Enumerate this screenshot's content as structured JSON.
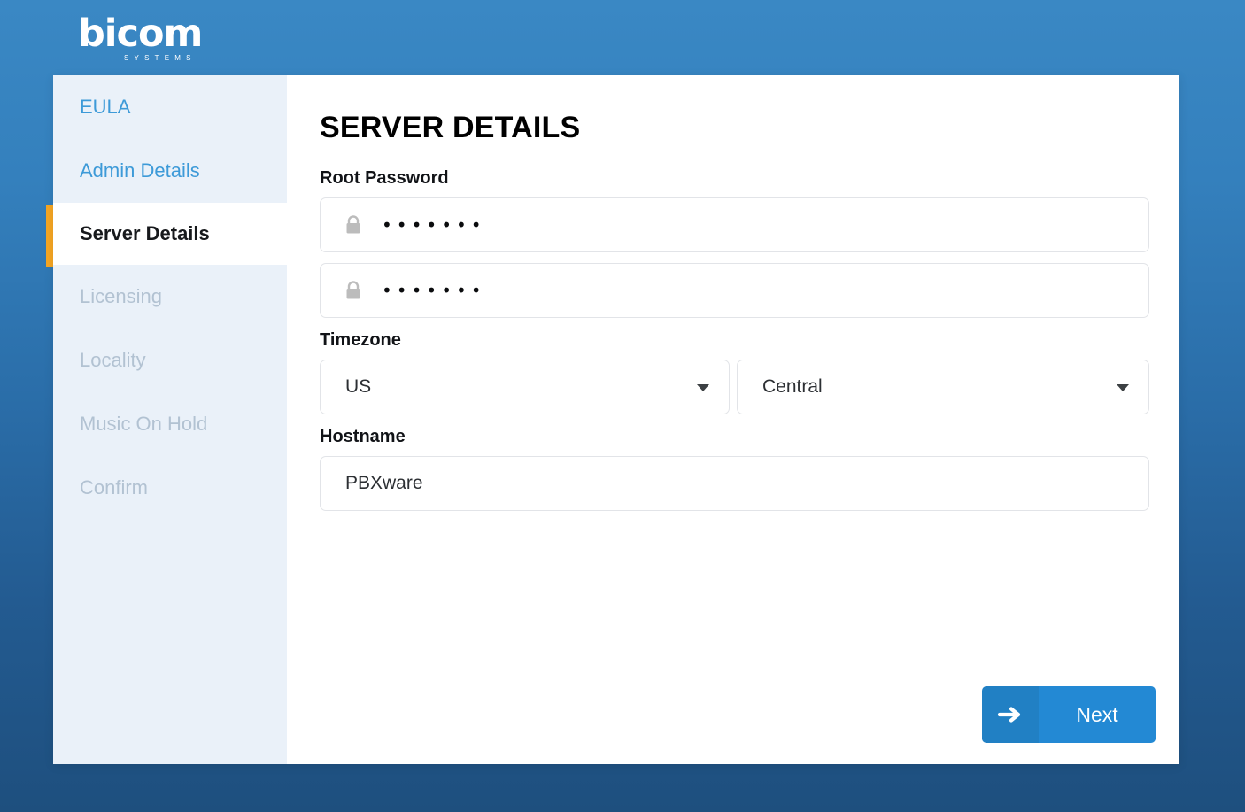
{
  "brand": {
    "name": "bicom",
    "tagline": "SYSTEMS"
  },
  "sidebar": {
    "items": [
      {
        "label": "EULA",
        "state": "done"
      },
      {
        "label": "Admin Details",
        "state": "done"
      },
      {
        "label": "Server Details",
        "state": "active"
      },
      {
        "label": "Licensing",
        "state": "disabled"
      },
      {
        "label": "Locality",
        "state": "disabled"
      },
      {
        "label": "Music On Hold",
        "state": "disabled"
      },
      {
        "label": "Confirm",
        "state": "disabled"
      }
    ],
    "active_marker_color": "#f5a623",
    "background_color": "#eaf1f9",
    "done_color": "#3d9ad8",
    "disabled_color": "#b2c2d2"
  },
  "main": {
    "title": "SERVER DETAILS",
    "root_password": {
      "label": "Root Password",
      "value": "•••••••",
      "confirm_value": "•••••••",
      "icon": "lock-icon"
    },
    "timezone": {
      "label": "Timezone",
      "region_value": "US",
      "zone_value": "Central"
    },
    "hostname": {
      "label": "Hostname",
      "value": "PBXware"
    }
  },
  "footer": {
    "next_label": "Next",
    "next_icon": "arrow-right-icon",
    "next_color": "#2389d4",
    "next_icon_color": "#2180c4"
  }
}
